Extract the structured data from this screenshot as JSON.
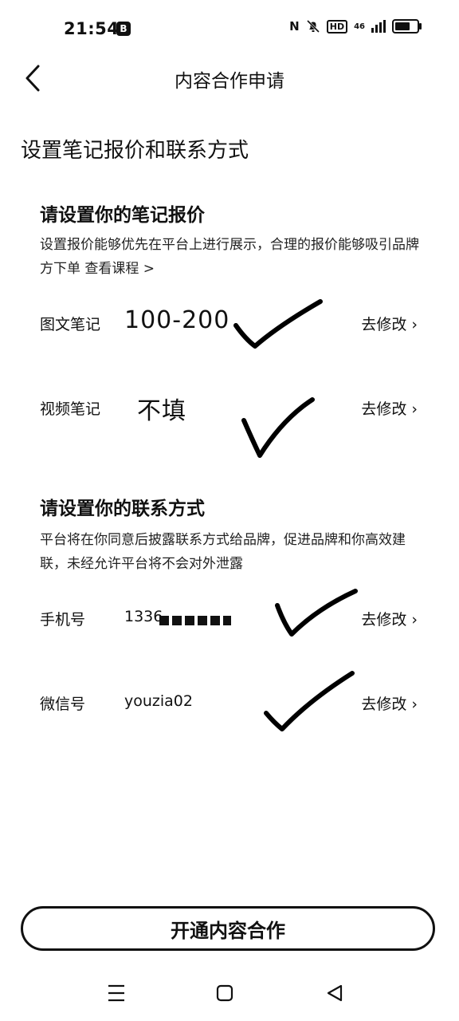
{
  "status_bar": {
    "time": "21:54",
    "app_badge": "B",
    "nfc": "N",
    "hd": "HD",
    "network": "46"
  },
  "header": {
    "title": "内容合作申请"
  },
  "page": {
    "heading": "设置笔记报价和联系方式"
  },
  "pricing": {
    "title": "请设置你的笔记报价",
    "desc": "设置报价能够优先在平台上进行展示，合理的报价能够吸引品牌方下单",
    "course_link": "查看课程 >",
    "rows": [
      {
        "label": "图文笔记",
        "value": "100-200",
        "edit": "去修改"
      },
      {
        "label": "视频笔记",
        "value": "不填",
        "edit": "去修改"
      }
    ]
  },
  "contact": {
    "title": "请设置你的联系方式",
    "desc": "平台将在你同意后披露联系方式给品牌，促进品牌和你高效建联，未经允许平台将不会对外泄露",
    "rows": [
      {
        "label": "手机号",
        "value": "1336",
        "edit": "去修改"
      },
      {
        "label": "微信号",
        "value": "youzia02",
        "edit": "去修改"
      }
    ]
  },
  "cta": {
    "label": "开通内容合作"
  }
}
